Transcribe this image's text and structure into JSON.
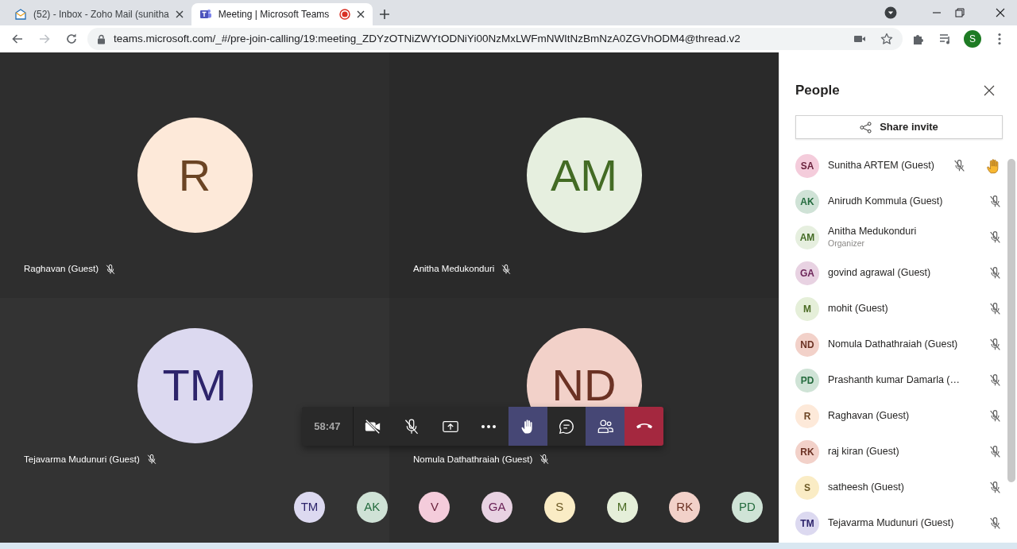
{
  "browser": {
    "tabs": [
      {
        "kind": "mail",
        "title": "(52) - Inbox - Zoho Mail (sunitha",
        "selected": false,
        "recording": false
      },
      {
        "kind": "teams",
        "title": "Meeting | Microsoft Teams",
        "selected": true,
        "recording": true
      }
    ],
    "url": "teams.microsoft.com/_#/pre-join-calling/19:meeting_ZDYzOTNiZWYtODNiYi00NzMxLWFmNWItNzBmNzA0ZGVhODM4@thread.v2",
    "profile_initial": "S"
  },
  "tiles": [
    {
      "initials": "R",
      "name": "Raghavan (Guest)",
      "muted": true,
      "color": "#fde9d9"
    },
    {
      "initials": "AM",
      "name": "Anitha Medukonduri",
      "muted": true,
      "color": "#e6efdf"
    },
    {
      "initials": "TM",
      "name": "Tejavarma Mudunuri (Guest)",
      "muted": true,
      "color": "#dcd9f0"
    },
    {
      "initials": "ND",
      "name": "Nomula Dathathraiah (Guest)",
      "muted": true,
      "color": "#f2d1c9"
    }
  ],
  "toolbar": {
    "timer": "58:47",
    "buttons": [
      {
        "kind": "camera",
        "selected": false
      },
      {
        "kind": "mic",
        "selected": false
      },
      {
        "kind": "share",
        "selected": false
      },
      {
        "kind": "more",
        "selected": false
      },
      {
        "kind": "hand",
        "selected": true
      },
      {
        "kind": "chat",
        "selected": false
      },
      {
        "kind": "people",
        "selected": true
      },
      {
        "kind": "hangup",
        "selected": false
      }
    ]
  },
  "overflow_avatars": [
    {
      "initials": "TM",
      "color": "#dcd9f0"
    },
    {
      "initials": "AK",
      "color": "#cfe2d6"
    },
    {
      "initials": "V",
      "color": "#f4ccdb"
    },
    {
      "initials": "GA",
      "color": "#e8d2e2"
    },
    {
      "initials": "S",
      "color": "#faecc5"
    },
    {
      "initials": "M",
      "color": "#e5efd9"
    },
    {
      "initials": "RK",
      "color": "#f2d1c9"
    },
    {
      "initials": "PD",
      "color": "#cfe3d6"
    }
  ],
  "people_panel": {
    "title": "People",
    "share_button": "Share invite",
    "participants": [
      {
        "initials": "SA",
        "name": "Sunitha ARTEM (Guest)",
        "color": "#f4ccdb",
        "muted": true,
        "hand_raised": true
      },
      {
        "initials": "AK",
        "name": "Anirudh Kommula (Guest)",
        "color": "#cfe2d6",
        "muted": true,
        "hand_raised": false
      },
      {
        "initials": "AM",
        "name": "Anitha Medukonduri",
        "role": "Organizer",
        "color": "#e6efdf",
        "muted": true,
        "hand_raised": false
      },
      {
        "initials": "GA",
        "name": "govind agrawal (Guest)",
        "color": "#e8d2e2",
        "muted": true,
        "hand_raised": false
      },
      {
        "initials": "M",
        "name": "mohit (Guest)",
        "color": "#e5efd9",
        "muted": true,
        "hand_raised": false
      },
      {
        "initials": "ND",
        "name": "Nomula Dathathraiah (Guest)",
        "color": "#f2d1c9",
        "muted": true,
        "hand_raised": false
      },
      {
        "initials": "PD",
        "name": "Prashanth kumar Damarla (…",
        "color": "#cfe3d6",
        "muted": true,
        "hand_raised": false
      },
      {
        "initials": "R",
        "name": "Raghavan (Guest)",
        "color": "#fde9d9",
        "muted": true,
        "hand_raised": false
      },
      {
        "initials": "RK",
        "name": "raj kiran (Guest)",
        "color": "#f2d1c9",
        "muted": true,
        "hand_raised": false
      },
      {
        "initials": "S",
        "name": "satheesh (Guest)",
        "color": "#faecc5",
        "muted": true,
        "hand_raised": false
      },
      {
        "initials": "TM",
        "name": "Tejavarma Mudunuri (Guest)",
        "color": "#dcd9f0",
        "muted": true,
        "hand_raised": false
      }
    ]
  }
}
